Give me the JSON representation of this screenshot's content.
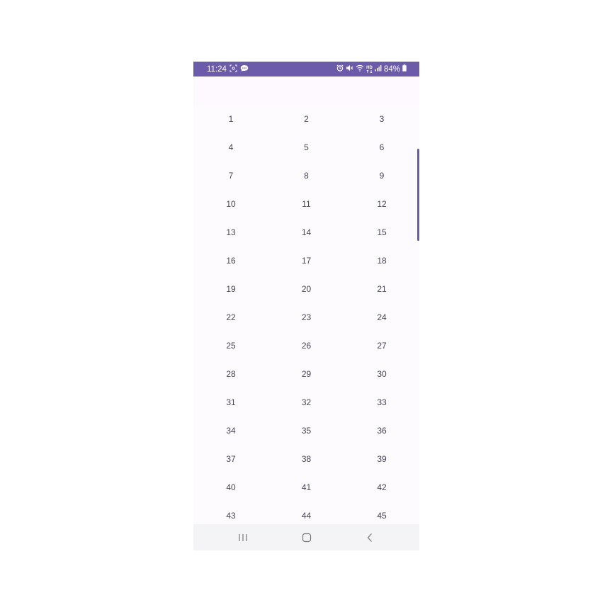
{
  "status_bar": {
    "time": "11:24",
    "battery": "84%",
    "network_label": "HD",
    "background_color": "#6b5ba9",
    "left_icons": [
      "screenshot-icon",
      "chat-bubble-icon"
    ],
    "right_icons": [
      "alarm-icon",
      "mute-icon",
      "wifi-icon",
      "signal-icon",
      "battery-icon"
    ]
  },
  "grid": {
    "items": [
      "1",
      "2",
      "3",
      "4",
      "5",
      "6",
      "7",
      "8",
      "9",
      "10",
      "11",
      "12",
      "13",
      "14",
      "15",
      "16",
      "17",
      "18",
      "19",
      "20",
      "21",
      "22",
      "23",
      "24",
      "25",
      "26",
      "27",
      "28",
      "29",
      "30",
      "31",
      "32",
      "33",
      "34",
      "35",
      "36",
      "37",
      "38",
      "39",
      "40",
      "41",
      "42",
      "43",
      "44",
      "45"
    ]
  },
  "nav_bar": {
    "icons": [
      "recent-apps-icon",
      "home-icon",
      "back-icon"
    ]
  },
  "colors": {
    "accent": "#6b5ba9",
    "text": "#4a4458",
    "background": "#fdfbfe"
  }
}
